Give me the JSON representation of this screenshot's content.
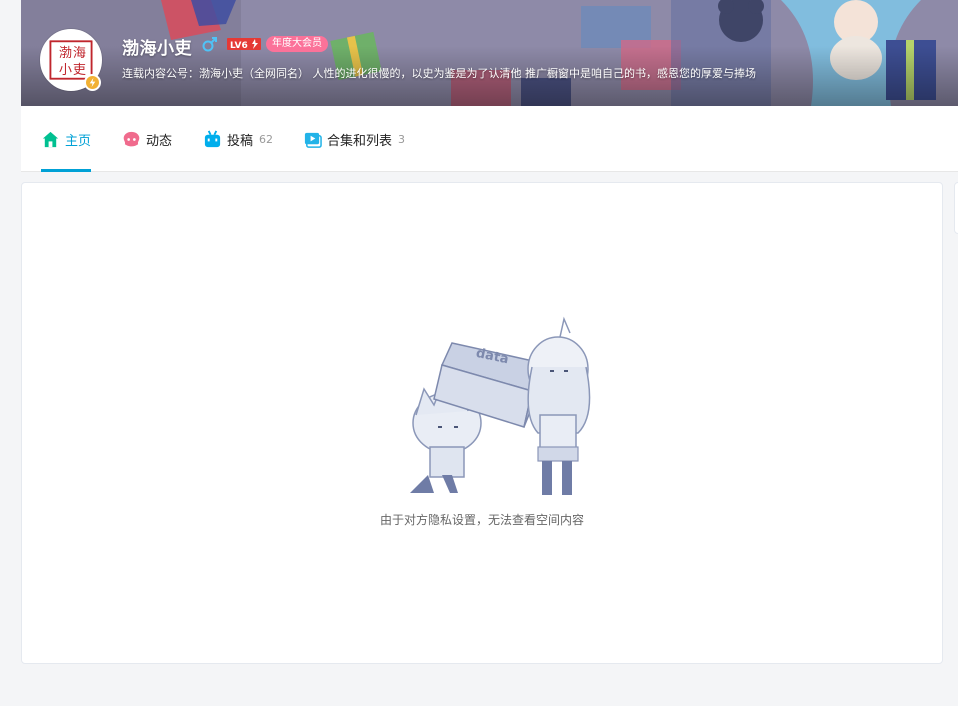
{
  "profile": {
    "username": "渤海小吏",
    "gender_icon": "male-icon",
    "level_label": "LV6",
    "vip_badge": "年度大会员",
    "sign": "连载内容公号：渤海小吏（全网同名） 人性的进化很慢的，以史为鉴是为了认清他 推广橱窗中是咱自己的书，感恩您的厚爱与捧场",
    "avatar_text": [
      "渤",
      "海",
      "小",
      "吏"
    ]
  },
  "nav": {
    "tabs": [
      {
        "label": "主页",
        "count": "",
        "icon": "home-icon",
        "active": true
      },
      {
        "label": "动态",
        "count": "",
        "icon": "dynamic-icon",
        "active": false
      },
      {
        "label": "投稿",
        "count": "62",
        "icon": "upload-icon",
        "active": false
      },
      {
        "label": "合集和列表",
        "count": "3",
        "icon": "collection-icon",
        "active": false
      }
    ]
  },
  "main": {
    "empty_illustration_text": "data",
    "empty_message": "由于对方隐私设置，无法查看空间内容"
  },
  "colors": {
    "accent": "#00a1d6",
    "vip_pink": "#fb7299",
    "level_red": "#e53935",
    "gender_blue": "#4fc3f7",
    "bolt_yellow": "#f2b134"
  }
}
